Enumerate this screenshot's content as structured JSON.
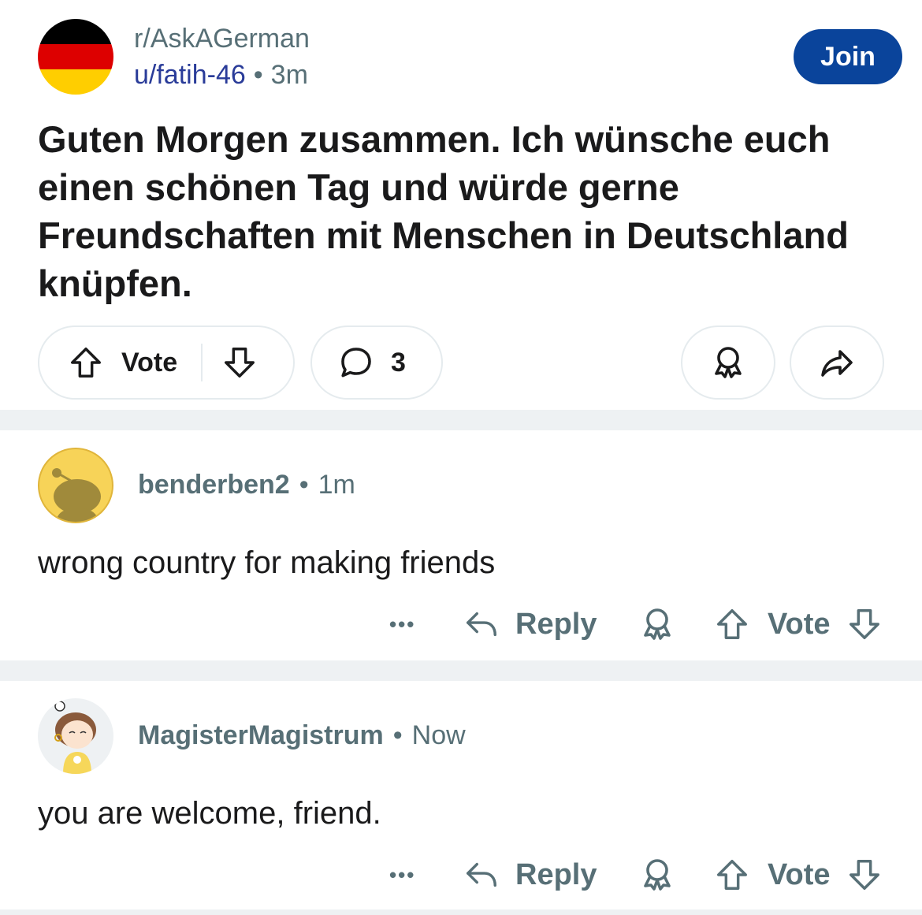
{
  "post": {
    "subreddit": "r/AskAGerman",
    "author": "u/fatih-46",
    "separator": "•",
    "time": "3m",
    "join_label": "Join",
    "title": "Guten Morgen zusammen. Ich wünsche euch einen schönen Tag und würde gerne Freundschaften mit Menschen in Deutschland knüpfen.",
    "vote_label": "Vote",
    "comment_count": "3",
    "flag_colors": [
      "#000000",
      "#dd0000",
      "#ffce00"
    ]
  },
  "comments": [
    {
      "author": "benderben2",
      "separator": "•",
      "time": "1m",
      "body": "wrong country for making friends",
      "more_label": "•••",
      "reply_label": "Reply",
      "vote_label": "Vote"
    },
    {
      "author": "MagisterMagistrum",
      "separator": "•",
      "time": "Now",
      "body": "you are welcome, friend.",
      "more_label": "•••",
      "reply_label": "Reply",
      "vote_label": "Vote"
    }
  ],
  "icons": {
    "upvote": "upvote-arrow-icon",
    "downvote": "downvote-arrow-icon",
    "comment": "comment-bubble-icon",
    "award": "award-icon",
    "share": "share-arrow-icon",
    "reply": "reply-arrow-icon",
    "more": "more-options-icon"
  },
  "colors": {
    "accent": "#0a449b",
    "meta_text": "#576f76",
    "username_link": "#2a3c99",
    "divider": "#eef1f3"
  }
}
